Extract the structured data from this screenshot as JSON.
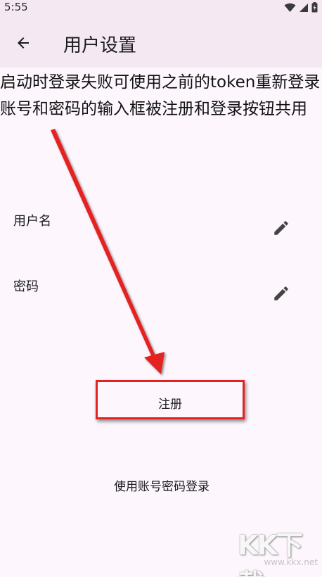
{
  "status_bar": {
    "time": "5:55",
    "icons": [
      "wifi-icon",
      "signal-icon",
      "battery-icon"
    ]
  },
  "app_bar": {
    "back_icon": "arrow-back-icon",
    "title": "用户设置"
  },
  "annotation_text": "启动时登录失败可使用之前的token重新登录 账号和密码的输入框被注册和登录按钮共用",
  "settings": [
    {
      "label": "用户名",
      "action_icon": "edit-icon"
    },
    {
      "label": "密码",
      "action_icon": "edit-icon"
    }
  ],
  "buttons": {
    "register_label": "注册",
    "login_label": "使用账号密码登录"
  },
  "watermark": {
    "logo_text": "KK下载",
    "url": "www.kkx.net"
  },
  "colors": {
    "app_bar_bg": "#f4e9f2",
    "page_bg": "#fdf7fd",
    "highlight_red": "#e02424"
  }
}
